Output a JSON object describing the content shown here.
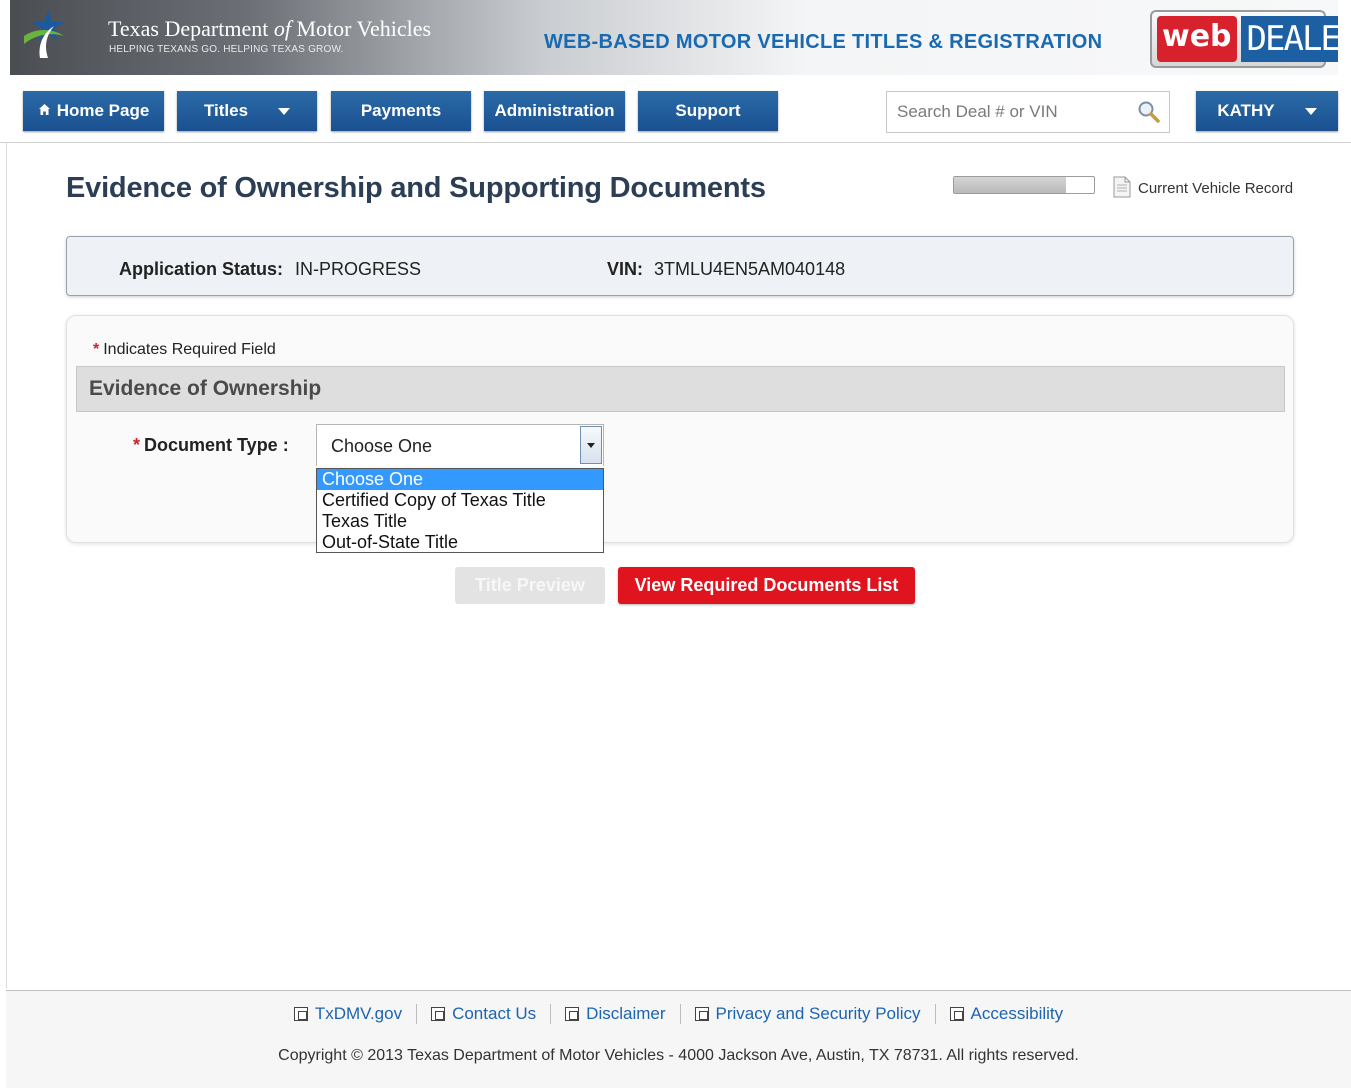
{
  "header": {
    "agency_name_part1": "Texas Department ",
    "agency_name_of": "of",
    "agency_name_part2": " Motor Vehicles",
    "tagline": "HELPING TEXANS GO. HELPING TEXAS GROW.",
    "system_name": "WEB-BASED MOTOR VEHICLE TITLES & REGISTRATION",
    "product_logo": {
      "web": "web",
      "dealer": "DEALER"
    }
  },
  "nav": {
    "home": "Home Page",
    "titles": "Titles",
    "payments": "Payments",
    "administration": "Administration",
    "support": "Support",
    "search_placeholder": "Search Deal # or VIN",
    "user": "KATHY"
  },
  "page": {
    "title": "Evidence of Ownership and Supporting Documents",
    "progress_fraction": 0.8,
    "current_vehicle_record": "Current Vehicle Record"
  },
  "status": {
    "app_status_label": "Application Status:",
    "app_status_value": "IN-PROGRESS",
    "vin_label": "VIN:",
    "vin_value": "3TMLU4EN5AM040148"
  },
  "form": {
    "required_asterisk": "*",
    "required_note": "Indicates Required Field",
    "section_title": "Evidence of Ownership",
    "document_type_label": "Document Type :",
    "document_type_value": "Choose One",
    "document_type_options": [
      "Choose One",
      "Certified Copy of Texas Title",
      "Texas Title",
      "Out-of-State Title"
    ]
  },
  "actions": {
    "title_preview": "Title Preview",
    "view_required_docs": "View Required Documents List"
  },
  "footer": {
    "links": [
      "TxDMV.gov",
      "Contact Us",
      "Disclaimer",
      "Privacy and Security Policy",
      "Accessibility"
    ],
    "copyright": "Copyright © 2013 Texas Department of Motor Vehicles - 4000 Jackson Ave, Austin, TX 78731. All rights reserved."
  },
  "colors": {
    "nav_blue": "#1b5190",
    "system_name_blue": "#1a6ab1",
    "required_red": "#d0212b",
    "button_red": "#e0141f",
    "dropdown_highlight": "#3399ff"
  }
}
